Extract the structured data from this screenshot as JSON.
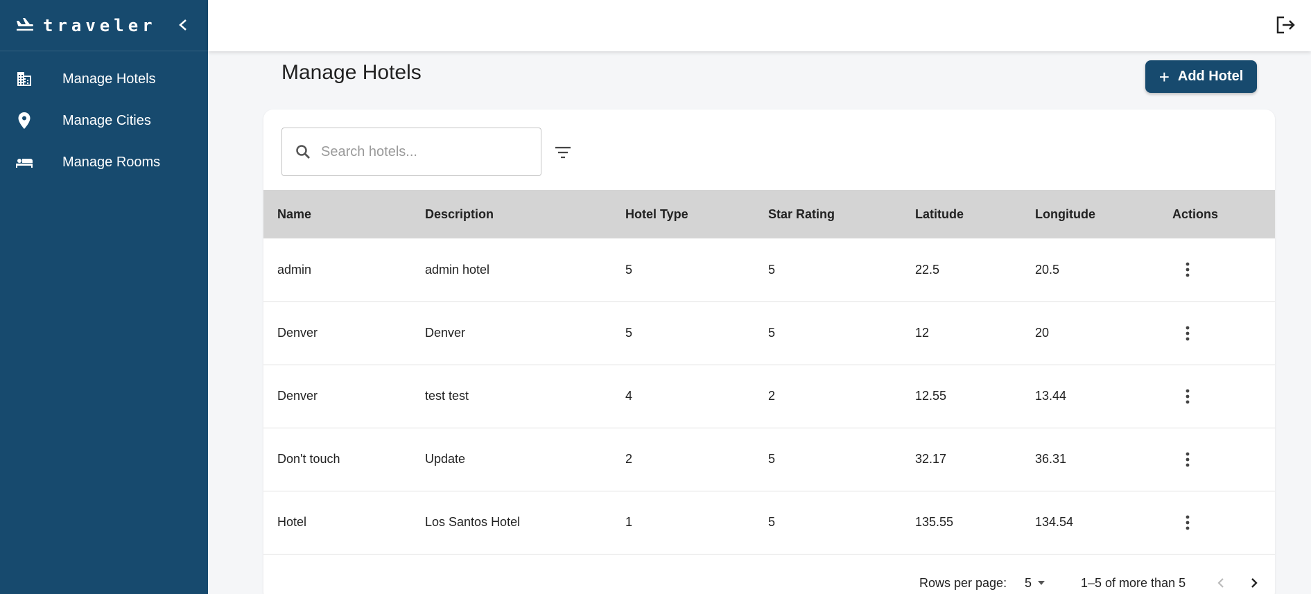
{
  "app": {
    "brand": "traveler",
    "colors": {
      "primary": "#174a6e",
      "header_row": "#d4d4d4",
      "background": "#f5f6f8"
    }
  },
  "sidebar": {
    "items": [
      {
        "label": "Manage Hotels",
        "icon": "building-icon"
      },
      {
        "label": "Manage Cities",
        "icon": "location-pin-icon"
      },
      {
        "label": "Manage Rooms",
        "icon": "bed-icon"
      }
    ]
  },
  "page": {
    "title": "Manage Hotels",
    "add_button_label": "Add Hotel"
  },
  "search": {
    "placeholder": "Search hotels...",
    "value": ""
  },
  "table": {
    "headers": [
      "Name",
      "Description",
      "Hotel Type",
      "Star Rating",
      "Latitude",
      "Longitude",
      "Actions"
    ],
    "rows": [
      {
        "name": "admin",
        "description": "admin hotel",
        "hotel_type": "5",
        "star_rating": "5",
        "latitude": "22.5",
        "longitude": "20.5"
      },
      {
        "name": "Denver",
        "description": "Denver",
        "hotel_type": "5",
        "star_rating": "5",
        "latitude": "12",
        "longitude": "20"
      },
      {
        "name": "Denver",
        "description": "test test",
        "hotel_type": "4",
        "star_rating": "2",
        "latitude": "12.55",
        "longitude": "13.44"
      },
      {
        "name": "Don't touch",
        "description": "Update",
        "hotel_type": "2",
        "star_rating": "5",
        "latitude": "32.17",
        "longitude": "36.31"
      },
      {
        "name": "Hotel",
        "description": "Los Santos Hotel",
        "hotel_type": "1",
        "star_rating": "5",
        "latitude": "135.55",
        "longitude": "134.54"
      }
    ]
  },
  "pagination": {
    "rows_per_page_label": "Rows per page:",
    "rows_per_page_value": "5",
    "range_text": "1–5 of more than 5"
  }
}
